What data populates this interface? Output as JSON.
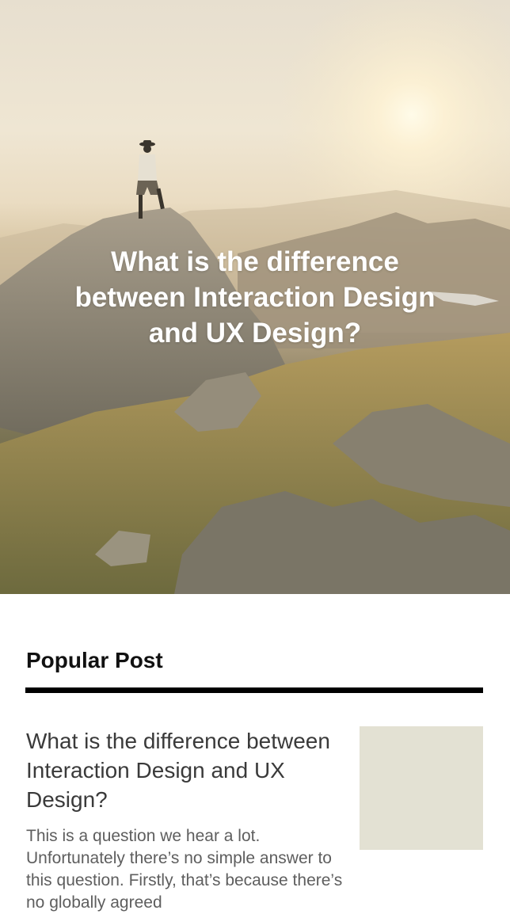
{
  "hero": {
    "title": "What is the difference between Interaction Design and UX Design?"
  },
  "popular": {
    "heading": "Popular Post",
    "post": {
      "title": "What is the difference between Interaction Design and UX Design?",
      "excerpt": "This is a question we hear a lot. Unfortunately there’s no simple answer to this question. Firstly, that’s because there’s no globally agreed"
    }
  },
  "colors": {
    "rule": "#000000",
    "thumb": "#e3e1d3",
    "post_title": "#3a3a3a",
    "post_excerpt": "#5e5e5e"
  }
}
